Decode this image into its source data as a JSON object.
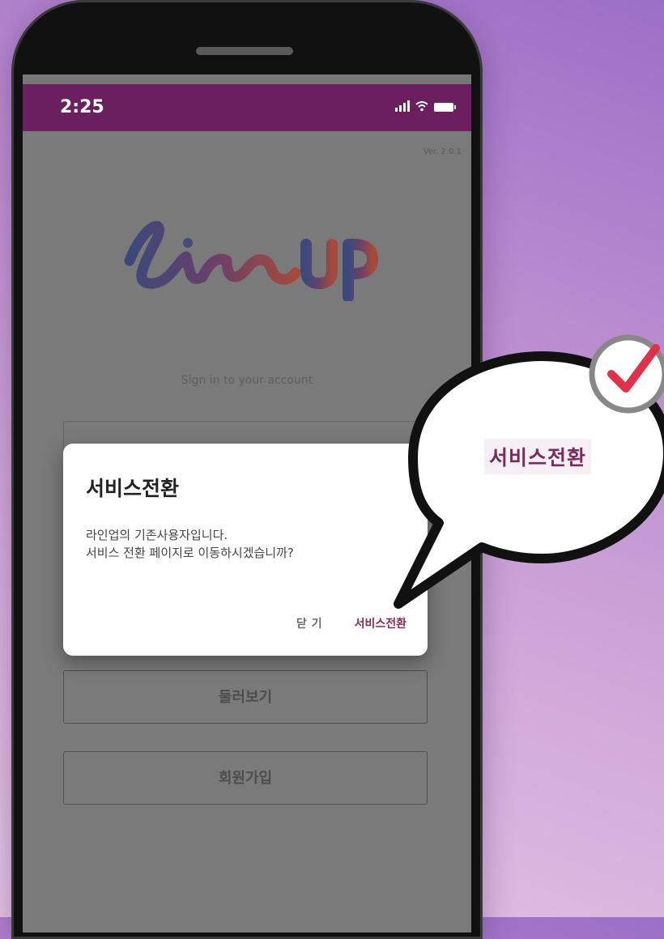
{
  "status": {
    "time": "2:25"
  },
  "app": {
    "version": "Ver. 2.0.1",
    "logo_text": "lineUP",
    "signin_prompt": "Sign in to your account",
    "browse_label": "둘러보기",
    "signup_label": "회원가입"
  },
  "dialog": {
    "title": "서비스전환",
    "message_line1": "라인업의 기존사용자입니다.",
    "message_line2": "서비스 전환 페이지로 이동하시겠습니까?",
    "close_label": "닫기",
    "switch_label": "서비스전환"
  },
  "callout": {
    "text": "서비스전환",
    "check_color": "#e0304a"
  },
  "colors": {
    "statusbar": "#6c1f5e",
    "accent": "#8a2a5a"
  }
}
